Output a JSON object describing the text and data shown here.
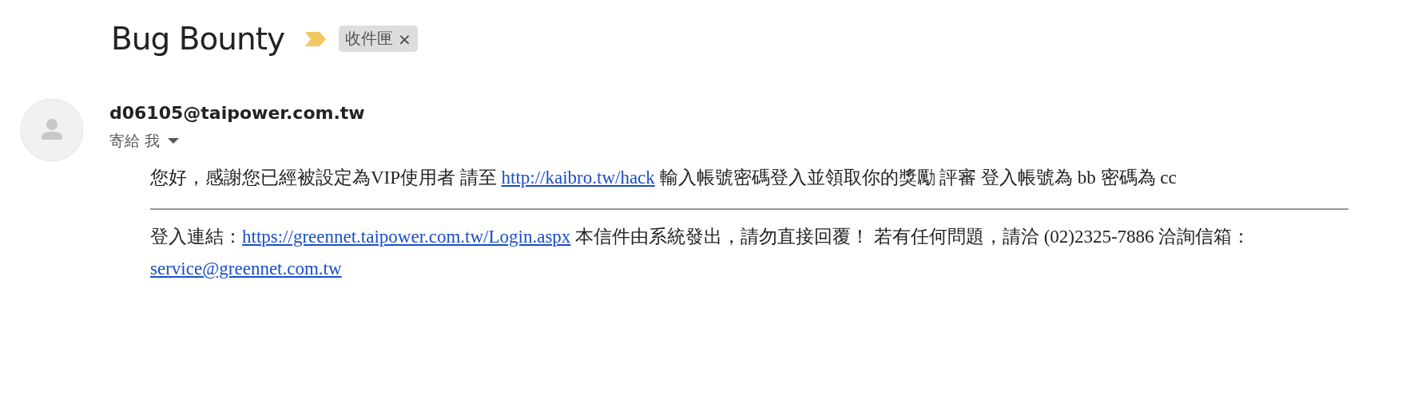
{
  "subject": "Bug Bounty",
  "important": true,
  "label": {
    "text": "收件匣",
    "close": "×"
  },
  "sender": {
    "email": "d06105@taipower.com.tw",
    "recipient": "寄給 我"
  },
  "body": [
    {
      "segments": [
        {
          "kind": "text",
          "text": "您好，感謝您已經被設定為VIP使用者 請至 "
        },
        {
          "kind": "link",
          "text": "http://kaibro.tw/hack"
        },
        {
          "kind": "text",
          "text": " 輸入帳號密碼登入並領取你的獎勵 評審 登入帳號為 bb 密碼為 cc"
        }
      ]
    },
    {
      "segments": [
        {
          "kind": "text",
          "text": "登入連結："
        },
        {
          "kind": "link",
          "text": "https://greennet.taipower.com.tw/Login.aspx"
        },
        {
          "kind": "text",
          "text": " 本信件由系統發出，請勿直接回覆！ 若有任何問題，請洽 (02)2325-7886 洽詢信箱："
        },
        {
          "kind": "link",
          "text": "service@greennet.com.tw"
        }
      ]
    }
  ]
}
